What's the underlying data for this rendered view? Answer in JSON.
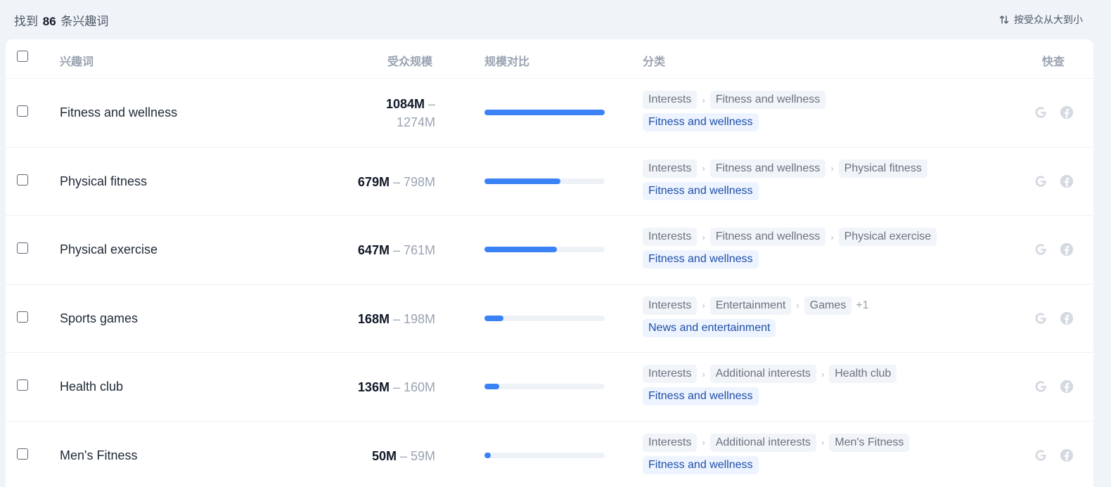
{
  "summary": {
    "prefix": "找到",
    "count": "86",
    "suffix": "条兴趣词"
  },
  "sort": {
    "label": "按受众从大到小",
    "icon": "sort-arrows-icon"
  },
  "table": {
    "headers": {
      "keyword": "兴趣词",
      "audience": "受众规模",
      "compare": "规模对比",
      "category": "分类",
      "quick": "快查"
    },
    "rows": [
      {
        "name": "Fitness and wellness",
        "size_low": "1084M",
        "size_high": "1274M",
        "dash": " –",
        "ratio": 1.0,
        "path": [
          "Interests",
          "Fitness and wellness"
        ],
        "extra": "",
        "topic": "Fitness and wellness"
      },
      {
        "name": "Physical fitness",
        "size_low": "679M",
        "size_high": "798M",
        "dash": " – ",
        "ratio": 0.63,
        "path": [
          "Interests",
          "Fitness and wellness",
          "Physical fitness"
        ],
        "extra": "",
        "topic": "Fitness and wellness"
      },
      {
        "name": "Physical exercise",
        "size_low": "647M",
        "size_high": "761M",
        "dash": " – ",
        "ratio": 0.6,
        "path": [
          "Interests",
          "Fitness and wellness",
          "Physical exercise"
        ],
        "extra": "",
        "topic": "Fitness and wellness"
      },
      {
        "name": "Sports games",
        "size_low": "168M",
        "size_high": "198M",
        "dash": " – ",
        "ratio": 0.155,
        "path": [
          "Interests",
          "Entertainment",
          "Games"
        ],
        "extra": "+1",
        "topic": "News and entertainment"
      },
      {
        "name": "Health club",
        "size_low": "136M",
        "size_high": "160M",
        "dash": " – ",
        "ratio": 0.125,
        "path": [
          "Interests",
          "Additional interests",
          "Health club"
        ],
        "extra": "",
        "topic": "Fitness and wellness"
      },
      {
        "name": "Men's Fitness",
        "size_low": "50M",
        "size_high": "59M",
        "dash": " – ",
        "ratio": 0.046,
        "path": [
          "Interests",
          "Additional interests",
          "Men's Fitness"
        ],
        "extra": "",
        "topic": "Fitness and wellness"
      }
    ]
  },
  "colors": {
    "bar": "#3b82f6",
    "icon_muted": "#d5dae2"
  },
  "icons": {
    "google": "google-icon",
    "facebook": "facebook-icon"
  }
}
